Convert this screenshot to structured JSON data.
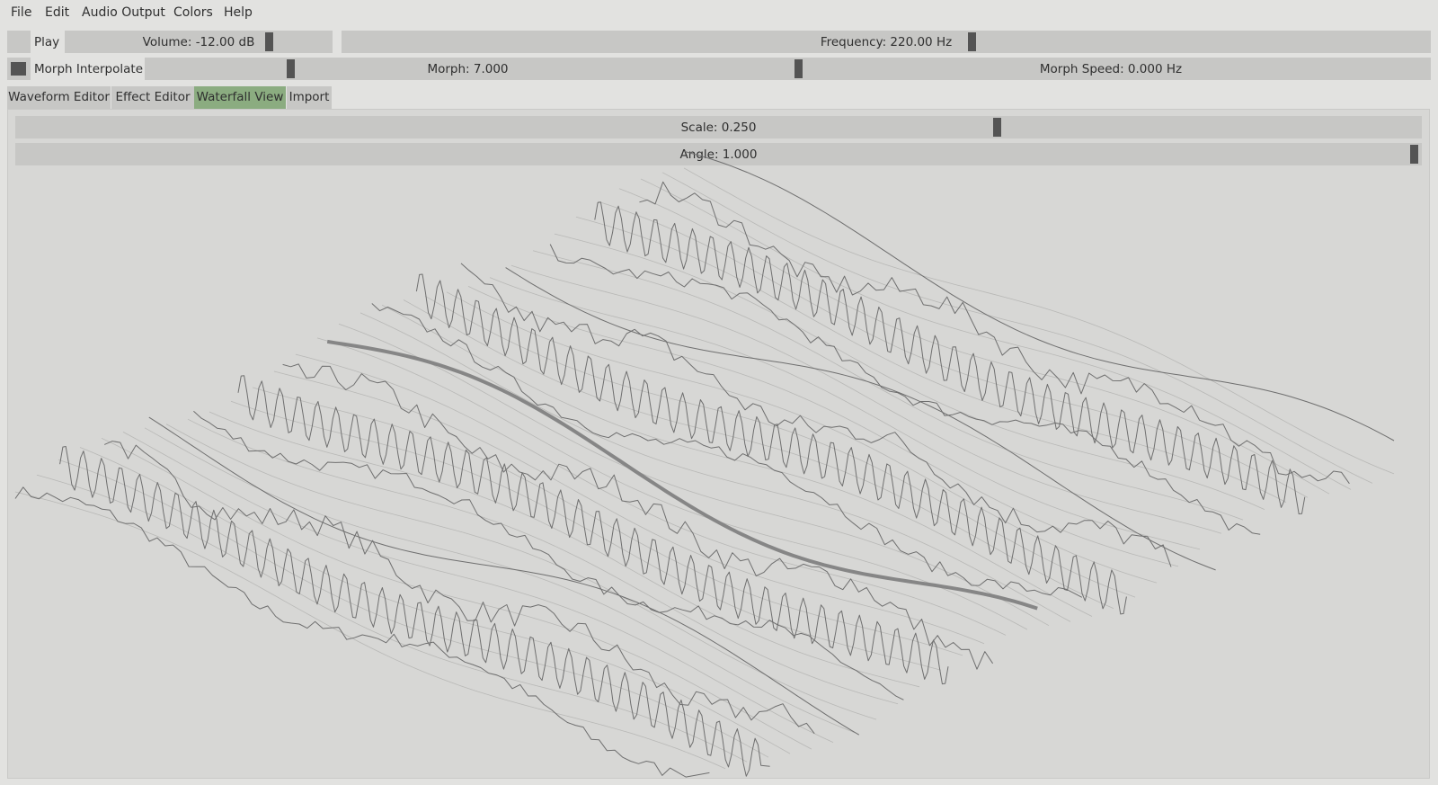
{
  "menu": {
    "file": "File",
    "edit": "Edit",
    "audio_output": "Audio Output",
    "colors": "Colors",
    "help": "Help"
  },
  "controls": {
    "play_label": "Play",
    "play_on": false,
    "volume_label": "Volume: -12.00 dB",
    "volume_position": 0.78,
    "frequency_label": "Frequency: 220.00 Hz",
    "frequency_position": 0.58,
    "morph_interpolate_label": "Morph Interpolate",
    "morph_interpolate_on": true,
    "morph_label": "Morph: 7.000",
    "morph_position": 0.22,
    "morph_speed_label": "Morph Speed: 0.000 Hz",
    "morph_speed_position": 0.0
  },
  "tabs": [
    {
      "label": "Waveform Editor",
      "active": false
    },
    {
      "label": "Effect Editor",
      "active": false
    },
    {
      "label": "Waterfall View",
      "active": true
    },
    {
      "label": "Import",
      "active": false
    }
  ],
  "waterfall": {
    "scale_label": "Scale: 0.250",
    "scale_position": 0.7,
    "angle_label": "Angle: 1.000",
    "angle_position": 1.0,
    "wave_count": 16,
    "highlighted_wave": 7,
    "colors": {
      "active_tab": "#8bac80",
      "slider_bg": "#c7c7c5",
      "handle": "#545454",
      "panel_bg": "#d7d7d5",
      "waveform": "#6f6f6f",
      "waveform_faint": "#b8b8b6",
      "waveform_highlight": "#868686"
    }
  }
}
